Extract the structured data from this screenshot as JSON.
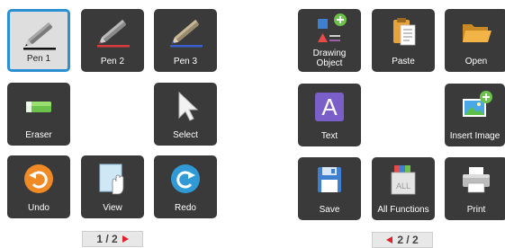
{
  "left_panel": {
    "tools": [
      {
        "label": "Pen 1",
        "icon": "pen-black-icon",
        "selected": true
      },
      {
        "label": "Pen 2",
        "icon": "pen-red-icon"
      },
      {
        "label": "Pen 3",
        "icon": "pen-blue-icon"
      },
      {
        "label": "Eraser",
        "icon": "eraser-icon"
      },
      {
        "label": "Select",
        "icon": "select-arrow-icon"
      },
      {
        "label": "Undo",
        "icon": "undo-icon"
      },
      {
        "label": "View",
        "icon": "view-hand-icon"
      },
      {
        "label": "Redo",
        "icon": "redo-icon"
      }
    ],
    "pager": {
      "text": "1 / 2",
      "arrow": "next"
    }
  },
  "right_panel": {
    "tools": [
      {
        "label_line1": "Drawing",
        "label_line2": "Object",
        "icon": "drawing-object-icon"
      },
      {
        "label": "Paste",
        "icon": "paste-icon"
      },
      {
        "label": "Open",
        "icon": "open-folder-icon"
      },
      {
        "label": "Text",
        "icon": "text-icon"
      },
      {
        "label": "Insert Image",
        "icon": "insert-image-icon"
      },
      {
        "label": "Save",
        "icon": "save-icon"
      },
      {
        "label": "All Functions",
        "icon": "all-functions-icon"
      },
      {
        "label": "Print",
        "icon": "print-icon"
      }
    ],
    "pager": {
      "text": "2 / 2",
      "arrow": "previous"
    }
  },
  "colors": {
    "tile_bg": "#3a3a3a",
    "selected_border": "#2b8fd3",
    "pen_black": "#111111",
    "pen_red": "#d83a3a",
    "pen_blue": "#3a5fcf",
    "eraser_green": "#6cc24a",
    "undo_orange": "#f08a24",
    "redo_blue": "#2f9ad6",
    "text_purple": "#7a5fc8",
    "pager_arrow": "#e0202a"
  },
  "icon_glyphs": {
    "text_letter": "A",
    "all_functions_letters": "ALL"
  }
}
